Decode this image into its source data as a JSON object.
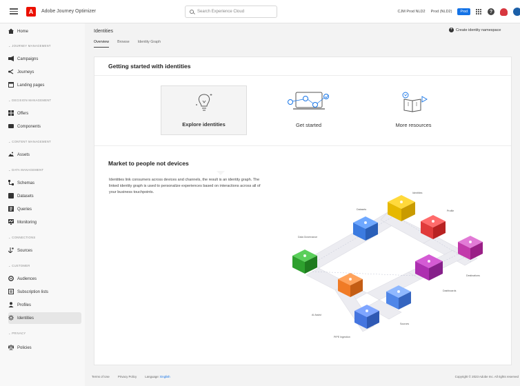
{
  "header": {
    "app_name": "Adobe Journey Optimizer",
    "logo_letter": "A",
    "search_placeholder": "Search Experience Cloud",
    "org": "CJM Prod NLD2",
    "sandbox": "Prod (NLD2)",
    "badge": "Prod",
    "help": "?"
  },
  "sidebar": {
    "home": "Home",
    "sections": {
      "journey": "JOURNEY MANAGEMENT",
      "decision": "DECISION MANAGEMENT",
      "content": "CONTENT MANAGEMENT",
      "data": "DATA MANAGEMENT",
      "connections": "CONNECTIONS",
      "customer": "CUSTOMER",
      "privacy": "PRIVACY"
    },
    "items": {
      "campaigns": "Campaigns",
      "journeys": "Journeys",
      "landing_pages": "Landing pages",
      "offers": "Offers",
      "components": "Components",
      "assets": "Assets",
      "schemas": "Schemas",
      "datasets": "Datasets",
      "queries": "Queries",
      "monitoring": "Monitoring",
      "sources": "Sources",
      "audiences": "Audiences",
      "subscription_lists": "Subscription lists",
      "profiles": "Profiles",
      "identities": "Identities",
      "policies": "Policies"
    }
  },
  "main": {
    "title": "Identities",
    "create_button": "Create identity namespace",
    "tabs": [
      "Overview",
      "Browse",
      "Identity Graph"
    ],
    "getting_started": "Getting started with identities",
    "options": {
      "explore": "Explore identities",
      "started": "Get started",
      "resources": "More resources"
    },
    "market_title": "Market to people not devices",
    "market_desc": "Identities link consumers across devices and channels, the result is an identity graph. The linked identity graph is used to personalize experiences based on interactions across all of your business touchpoints.",
    "graph_labels": {
      "identities": "Identities",
      "datasets": "Datasets",
      "profile": "Profile",
      "data_governance": "Data Governance",
      "destinations": "Destinations",
      "dashboards": "Dashboards",
      "ai_assist": "AI Assist",
      "sources": "Sources",
      "pipe_ingestion": "PIPE Ingestion"
    }
  },
  "footer": {
    "terms": "Terms of Use",
    "privacy": "Privacy Policy",
    "language_label": "Language:",
    "language": "English",
    "copyright": "Copyright © 2023 Adobe Inc. All rights reserved"
  },
  "colors": {
    "accent": "#1473e6",
    "adobe_red": "#eb1000"
  }
}
